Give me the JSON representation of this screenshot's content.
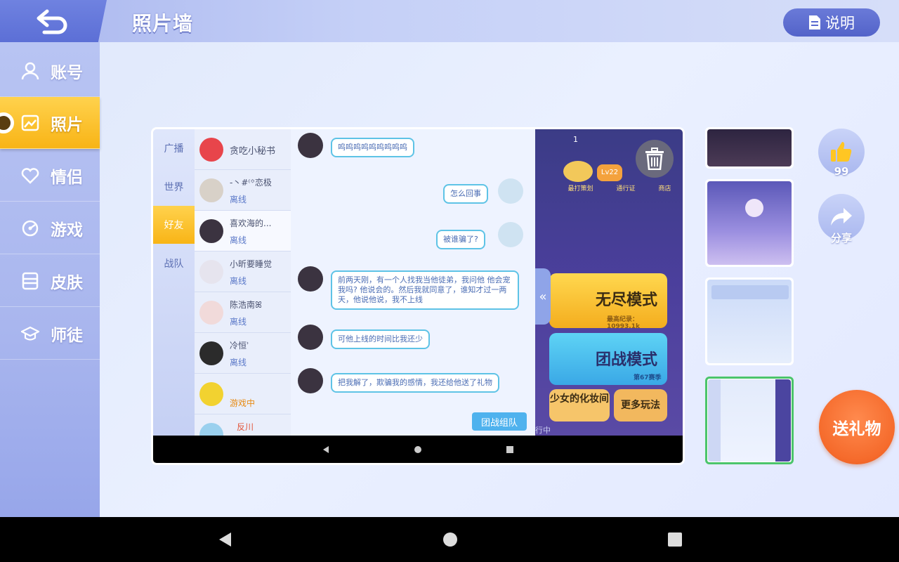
{
  "header": {
    "title": "照片墙",
    "help_label": "说明"
  },
  "sidebar": {
    "items": [
      {
        "label": "账号",
        "icon": "person-icon"
      },
      {
        "label": "照片",
        "icon": "photo-icon",
        "active": true
      },
      {
        "label": "情侣",
        "icon": "heart-icon"
      },
      {
        "label": "游戏",
        "icon": "game-icon"
      },
      {
        "label": "皮肤",
        "icon": "skin-icon"
      },
      {
        "label": "师徒",
        "icon": "graduation-icon"
      }
    ]
  },
  "photo": {
    "tabs": [
      "广播",
      "世界",
      "好友",
      "战队"
    ],
    "active_tab": "好友",
    "contacts": [
      {
        "name": "贪吃小秘书",
        "status": ""
      },
      {
        "name": "-丶#⁽꙳恋极",
        "status": "离线"
      },
      {
        "name": "喜欢海的...",
        "status": "离线"
      },
      {
        "name": "小昕要睡觉",
        "status": "离线"
      },
      {
        "name": "陈浩南ꕤ",
        "status": "离线"
      },
      {
        "name": "冷恒ʾ",
        "status": "离线"
      },
      {
        "name": "",
        "status": "游戏中"
      },
      {
        "name": "反川",
        "status": ""
      }
    ],
    "messages": [
      {
        "side": "left",
        "text": "呜呜呜呜呜呜呜呜呜"
      },
      {
        "side": "right",
        "text": "怎么回事"
      },
      {
        "side": "right",
        "text": "被谁骗了?"
      },
      {
        "side": "left",
        "text": "前两天刚，有一个人找我当他徒弟，我问他 他会宠我吗? 他说会的。然后我就同意了，谁知才过一两天，他说他说，我不上线"
      },
      {
        "side": "left",
        "text": "可他上线的时间比我还少"
      },
      {
        "side": "left",
        "text": "把我解了，欺骗我的感情，我还给他送了礼物"
      }
    ],
    "team_button": "团战组队",
    "game": {
      "level": "Lv22",
      "menu": [
        "最打策划",
        "通行证",
        "商店"
      ],
      "endless": {
        "title": "无尽模式",
        "record": "最高纪录：10993.1k"
      },
      "team_battle": {
        "title": "团战模式",
        "season": "第67赛季"
      },
      "panel_left": "少女的化妆间",
      "panel_right": "更多玩法",
      "coin_count": "1",
      "footer_text": "行中"
    }
  },
  "actions": {
    "like_count": "99",
    "share_label": "分享",
    "gift_label": "送礼物"
  }
}
